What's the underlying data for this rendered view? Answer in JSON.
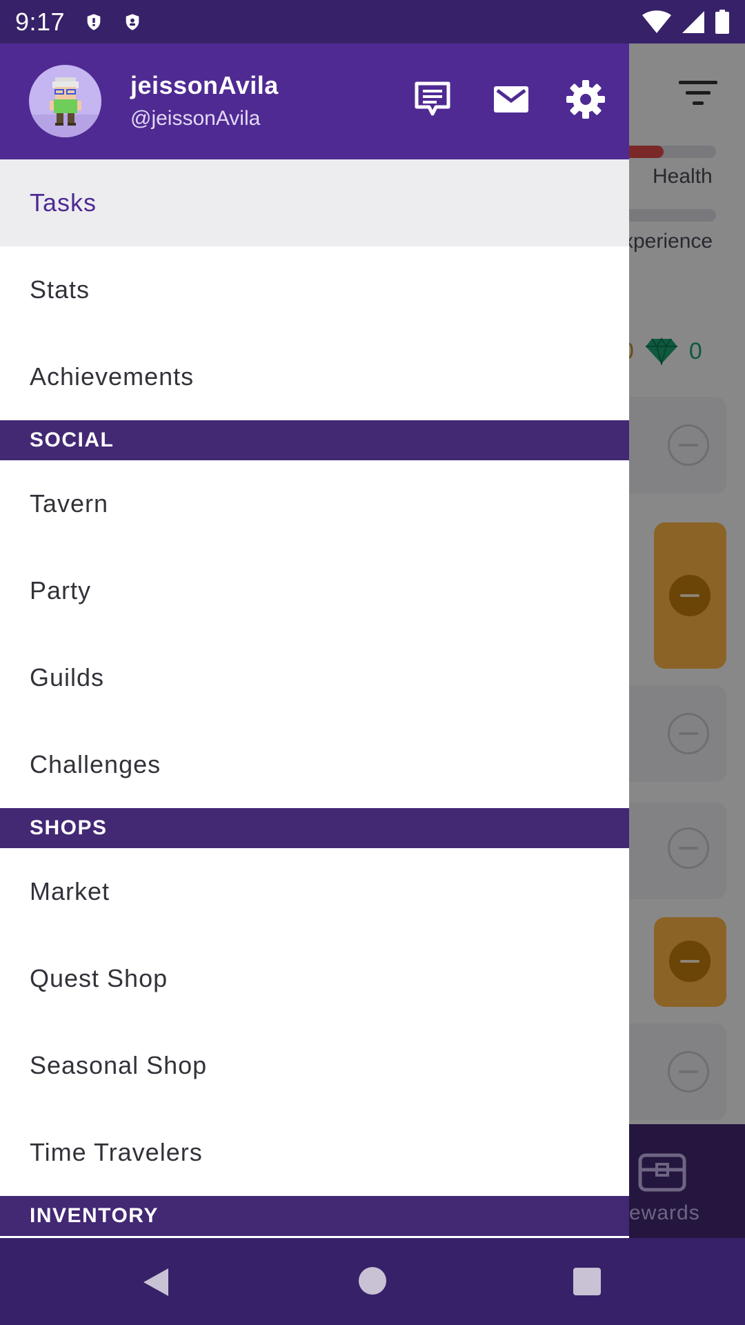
{
  "status_bar": {
    "time": "9:17"
  },
  "user": {
    "name": "jeissonAvila",
    "handle": "@jeissonAvila"
  },
  "menu": {
    "top_items": [
      "Tasks",
      "Stats",
      "Achievements"
    ],
    "sections": [
      {
        "title": "SOCIAL",
        "items": [
          "Tavern",
          "Party",
          "Guilds",
          "Challenges"
        ]
      },
      {
        "title": "SHOPS",
        "items": [
          "Market",
          "Quest Shop",
          "Seasonal Shop",
          "Time Travelers"
        ]
      },
      {
        "title": "INVENTORY",
        "items": []
      }
    ],
    "active_item": "Tasks"
  },
  "background": {
    "health_label": "Health",
    "experience_label": "xperience",
    "gold_value": "0",
    "gems_value": "0",
    "rewards_label": "ewards"
  },
  "icons": [
    "shield-icon",
    "wifi-icon",
    "signal-icon",
    "battery-icon",
    "chat-icon",
    "mail-icon",
    "settings-gear-icon",
    "filter-icon",
    "gem-icon",
    "chest-icon",
    "back-icon",
    "home-icon",
    "recents-icon"
  ],
  "colors": {
    "header_purple": "#4f2a93",
    "section_purple": "#432874",
    "statusbar": "#372169",
    "active_bg": "#ededf0"
  }
}
